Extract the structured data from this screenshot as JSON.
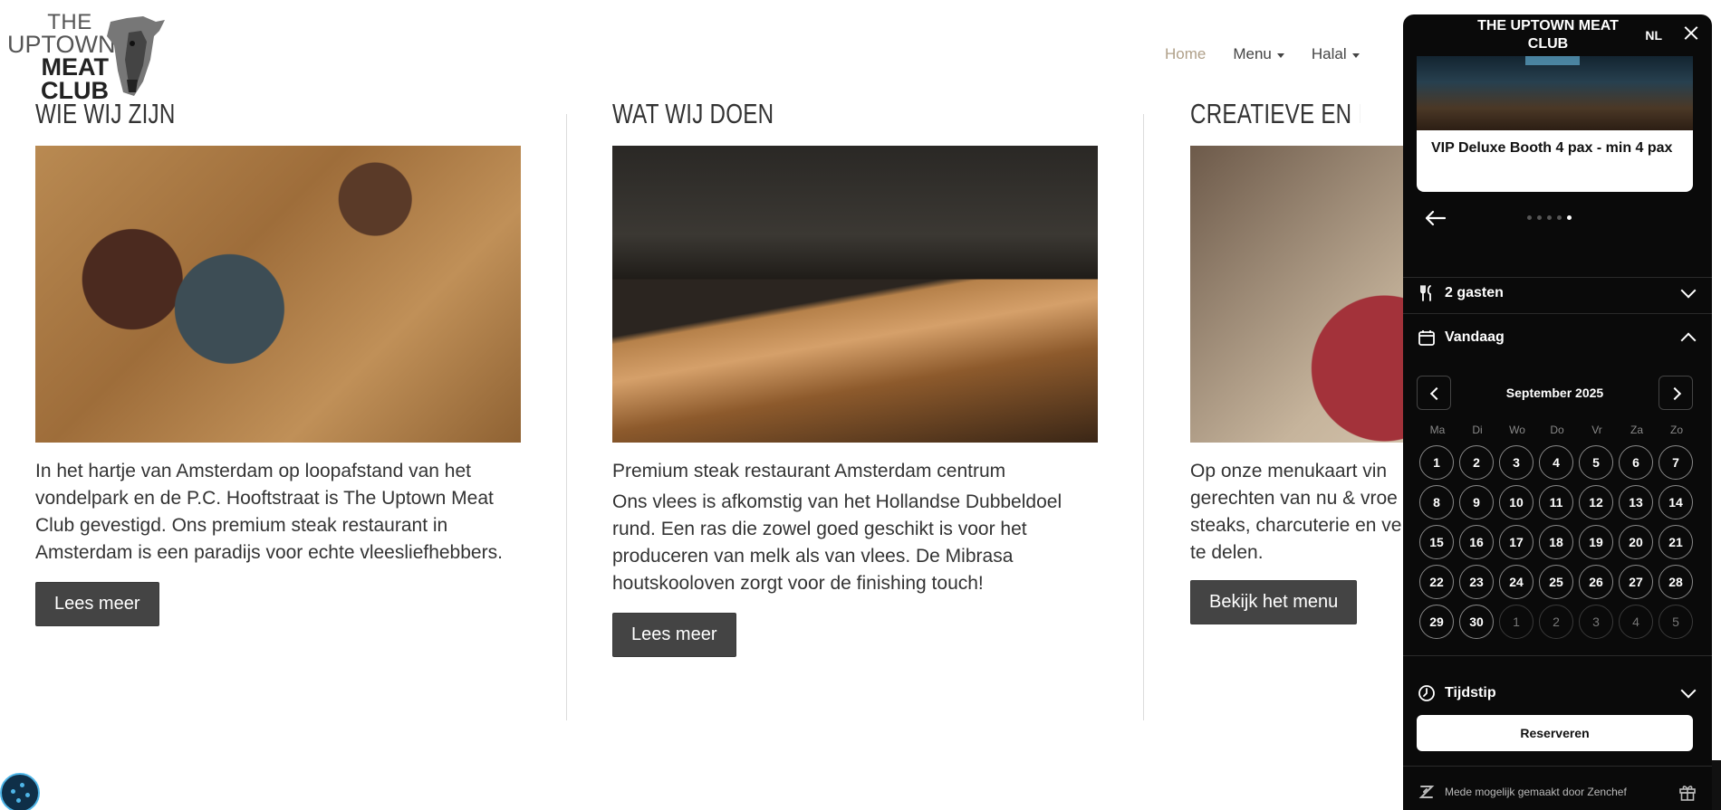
{
  "logo": {
    "line1": "THE",
    "line2": "UPTOWN",
    "line3": "MEAT",
    "line4": "CLUB"
  },
  "nav": [
    {
      "label": "Home",
      "active": true
    },
    {
      "label": "Menu",
      "dropdown": true
    },
    {
      "label": "Halal",
      "dropdown": true
    }
  ],
  "columns": [
    {
      "heading": "WIE WIJ ZIJN",
      "paragraphs": [
        "In het hartje van Amsterdam op loopafstand van het vondelpark en de P.C. Hooftstraat is The Uptown Meat Club gevestigd. Ons premium steak restaurant in Amsterdam is een paradijs voor echte vleesliefhebbers."
      ],
      "button": "Lees meer"
    },
    {
      "heading": "WAT WIJ DOEN",
      "subtitle": "Premium steak restaurant Amsterdam centrum",
      "paragraphs": [
        "Ons vlees is afkomstig van het Hollandse Dubbeldoel rund. Een ras die zowel goed geschikt is voor het produceren van melk als van vlees. De Mibrasa houtskooloven zorgt voor de finishing touch!"
      ],
      "button": "Lees meer"
    },
    {
      "heading": "CREATIEVE EN KLASSI",
      "paragraphs": [
        "Op onze menukaart vin gerechten van nu & vroe steaks, charcuterie en ve te delen."
      ],
      "button": "Bekijk het menu"
    }
  ],
  "widget": {
    "title": "THE UPTOWN MEAT CLUB",
    "language": "NL",
    "card_label": "VIP Deluxe Booth 4 pax - min 4 pax",
    "carousel_dots": 5,
    "carousel_active": 5,
    "guests_label": "2 gasten",
    "date_label": "Vandaag",
    "month_label": "September 2025",
    "weekdays": [
      "Ma",
      "Di",
      "Wo",
      "Do",
      "Vr",
      "Za",
      "Zo"
    ],
    "days": [
      "1",
      "2",
      "3",
      "4",
      "5",
      "6",
      "7",
      "8",
      "9",
      "10",
      "11",
      "12",
      "13",
      "14",
      "15",
      "16",
      "17",
      "18",
      "19",
      "20",
      "21",
      "22",
      "23",
      "24",
      "25",
      "26",
      "27",
      "28",
      "29",
      "30"
    ],
    "next_month_days": [
      "1",
      "2",
      "3",
      "4",
      "5"
    ],
    "time_label": "Tijdstip",
    "reserve_label": "Reserveren",
    "footer_text": "Mede mogelijk gemaakt door Zenchef"
  },
  "icons": {
    "close": "close-icon",
    "back": "arrow-left-icon",
    "guests": "cutlery-icon",
    "date": "calendar-icon",
    "time": "clock-icon",
    "footer_logo": "zenchef-logo-icon",
    "gift": "gift-icon",
    "cookie": "cookie-settings-icon"
  }
}
